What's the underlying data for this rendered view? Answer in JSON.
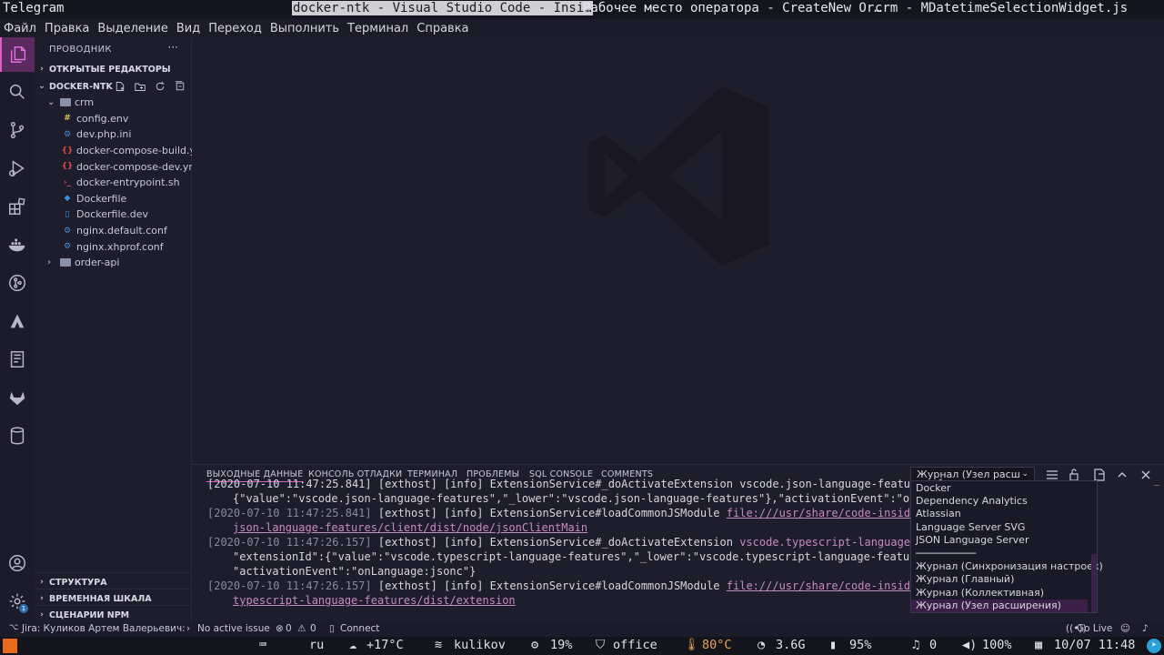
{
  "topbar": {
    "tabs": [
      "Telegram",
      "docker-ntk - Visual Studio Code - Insi…",
      "Рабочее место оператора - CreateNew Or…",
      "crm - MDatetimeSelectionWidget.js"
    ]
  },
  "menu": [
    "Файл",
    "Правка",
    "Выделение",
    "Вид",
    "Переход",
    "Выполнить",
    "Терминал",
    "Справка"
  ],
  "sidebar": {
    "title": "ПРОВОДНИК",
    "open_editors": "ОТКРЫТЫЕ РЕДАКТОРЫ",
    "workspace": "DOCKER-NTK",
    "tree": [
      {
        "name": "crm",
        "type": "folder-open",
        "depth": 1
      },
      {
        "name": "config.env",
        "type": "env",
        "depth": 2
      },
      {
        "name": "dev.php.ini",
        "type": "gear",
        "depth": 2
      },
      {
        "name": "docker-compose-build.y…",
        "type": "braces",
        "depth": 2
      },
      {
        "name": "docker-compose-dev.ym…",
        "type": "braces",
        "depth": 2
      },
      {
        "name": "docker-entrypoint.sh",
        "type": "shell",
        "depth": 2
      },
      {
        "name": "Dockerfile",
        "type": "docker",
        "depth": 2
      },
      {
        "name": "Dockerfile.dev",
        "type": "file",
        "depth": 2
      },
      {
        "name": "nginx.default.conf",
        "type": "gear",
        "depth": 2
      },
      {
        "name": "nginx.xhprof.conf",
        "type": "gear",
        "depth": 2
      },
      {
        "name": "order-api",
        "type": "folder",
        "depth": 1
      }
    ],
    "bottom_sections": [
      "СТРУКТУРА",
      "ВРЕМЕННАЯ ШКАЛА",
      "СЦЕНАРИИ NPM"
    ]
  },
  "panel": {
    "tabs": [
      "ВЫХОДНЫЕ ДАННЫЕ",
      "КОНСОЛЬ ОТЛАДКИ",
      "ТЕРМИНАЛ",
      "ПРОБЛЕМЫ",
      "SQL CONSOLE",
      "COMMENTS"
    ],
    "selected_channel": "Журнал (Узел расш",
    "output_lines": [
      {
        "ts": "",
        "text": "[2020-07-10 11:47:25.841] [exthost] [info] ExtensionService#_doActivateExtension vscode.json-language-features {",
        "link": "",
        "indent": false
      },
      {
        "ts": "",
        "text": "{\"value\":\"vscode.json-language-features\",\"_lower\":\"vscode.json-language-features\"},\"activationEvent\":\"on",
        "link": "",
        "indent": true
      },
      {
        "ts": "[2020-07-10 11:47:25.841]",
        "text": " [exthost] [info] ExtensionService#loadCommonJSModule ",
        "link": "file:///usr/share/code-inside",
        "indent": false
      },
      {
        "ts": "",
        "text": "",
        "link": "json-language-features/client/dist/node/jsonClientMain",
        "indent": true
      },
      {
        "ts": "[2020-07-10 11:47:26.157]",
        "text": " [exthost] [info] ExtensionService#_doActivateExtension ",
        "link": "vscode.typescript-language-",
        "indent": false
      },
      {
        "ts": "",
        "text": "\"extensionId\":{\"value\":\"vscode.typescript-language-features\",\"_lower\":\"vscode.typescript-language-featur",
        "link": "",
        "indent": true
      },
      {
        "ts": "",
        "text": "\"activationEvent\":\"onLanguage:jsonc\"}",
        "link": "",
        "indent": true
      },
      {
        "ts": "[2020-07-10 11:47:26.157]",
        "text": " [exthost] [info] ExtensionService#loadCommonJSModule ",
        "link": "file:///usr/share/code-inside",
        "indent": false
      },
      {
        "ts": "",
        "text": "",
        "link": "typescript-language-features/dist/extension",
        "indent": true
      }
    ],
    "dropdown_options": [
      "Docker",
      "Dependency Analytics",
      "Atlassian",
      "Language Server SVG",
      "JSON Language Server",
      "──────────",
      "Журнал (Синхронизация настроек)",
      "Журнал (Главный)",
      "Журнал (Коллективная)",
      "Журнал (Узел расширения)"
    ],
    "dropdown_selected_index": 9
  },
  "statusbar": {
    "jira": "Jira: Куликов Артем Валерьевич:",
    "issue": "No active issue",
    "errors": "0",
    "warnings": "0",
    "connect": "Connect",
    "golive": "Go Live"
  },
  "taskbar": {
    "lang": "ru",
    "weather": "+17°C",
    "wifi": "kulikov",
    "cpu": "19%",
    "network": "office",
    "temp": "80°C",
    "mem": "3.6G",
    "battery": "95%",
    "notifications": "0",
    "volume": "100%",
    "datetime": "10/07 11:48"
  },
  "colors": {
    "accent": "#d860c8",
    "background": "#1e1d2b",
    "activity_bar": "#1c1b29",
    "link": "#c88ac0",
    "temp_warning": "#e8a050",
    "taskbar_logo": "#e86a1a"
  }
}
